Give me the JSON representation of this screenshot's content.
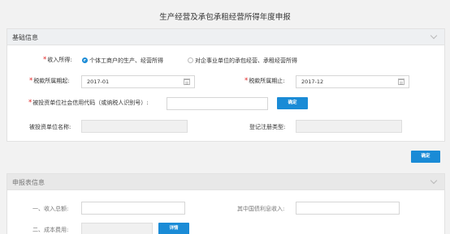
{
  "page_title": "生产经营及承包承租经营所得年度申报",
  "basic": {
    "header": "基础信息",
    "income_label": "收入所得:",
    "radio_option_1": "个体工商户的生产、经营所得",
    "radio_option_2": "对企事业单位的承包经营、承租经营所得",
    "period_start_label": "税款所属期起:",
    "period_start_value": "2017-01",
    "period_end_label": "税款所属期止:",
    "period_end_value": "2017-12",
    "credit_code_label": "被投资单位社会信用代码（或纳税人识别号）:",
    "credit_code_value": "",
    "confirm_inner": "确定",
    "company_name_label": "被投资单位名称:",
    "company_name_value": "",
    "reg_type_label": "登记注册类型:",
    "reg_type_value": ""
  },
  "confirm_outer": "确定",
  "declaration": {
    "header": "申报表信息",
    "total_income_label": "一、收入总额:",
    "total_income_value": "",
    "other_income_label": "其中国债利息收入:",
    "other_income_value": "",
    "cost_label": "二、成本费用:",
    "cost_value": "",
    "detail_button": "详情"
  },
  "colors": {
    "accent": "#1a8bd6",
    "required": "#e02020"
  }
}
